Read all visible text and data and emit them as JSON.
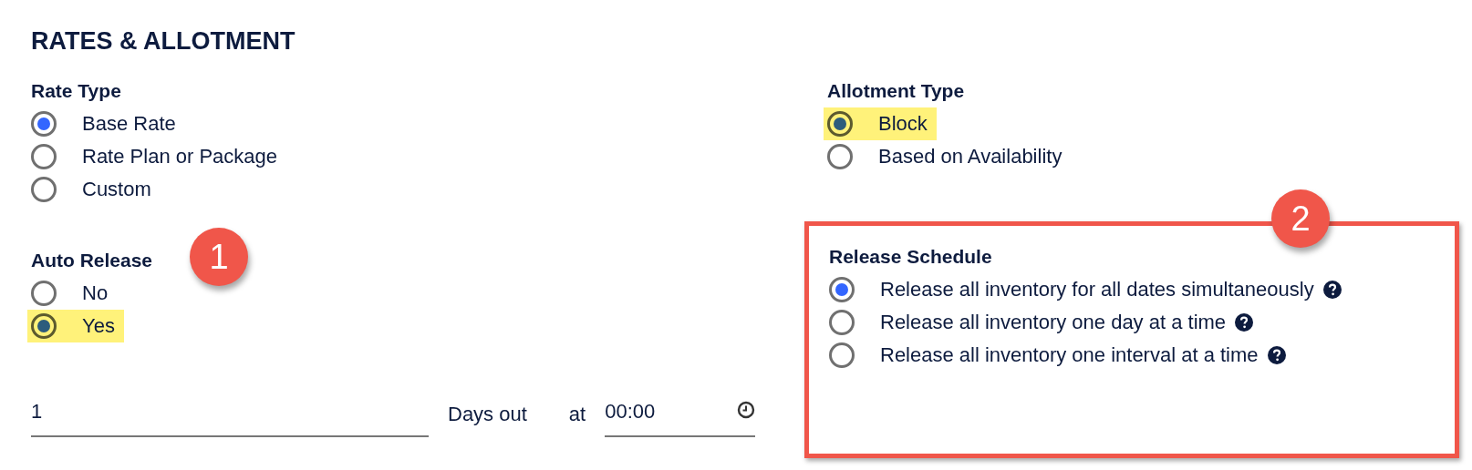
{
  "title": "RATES & ALLOTMENT",
  "rate_type": {
    "label": "Rate Type",
    "options": [
      {
        "label": "Base Rate",
        "selected": true,
        "highlighted": false
      },
      {
        "label": "Rate Plan or Package",
        "selected": false,
        "highlighted": false
      },
      {
        "label": "Custom",
        "selected": false,
        "highlighted": false
      }
    ]
  },
  "auto_release": {
    "label": "Auto Release",
    "callout": "1",
    "options": [
      {
        "label": "No",
        "selected": false,
        "highlighted": false
      },
      {
        "label": "Yes",
        "selected": true,
        "highlighted": true
      }
    ]
  },
  "release_fields": {
    "days": {
      "value": "1"
    },
    "days_label": "Days out",
    "at_label": "at",
    "time": {
      "value": "00:00"
    }
  },
  "allotment_type": {
    "label": "Allotment Type",
    "options": [
      {
        "label": "Block",
        "selected": true,
        "highlighted": true
      },
      {
        "label": "Based on Availability",
        "selected": false,
        "highlighted": false
      }
    ]
  },
  "release_schedule": {
    "label": "Release Schedule",
    "callout": "2",
    "framed": true,
    "options": [
      {
        "label": "Release all inventory for all dates simultaneously",
        "selected": true,
        "highlighted": false,
        "help": true
      },
      {
        "label": "Release all inventory one day at a time",
        "selected": false,
        "highlighted": false,
        "help": true
      },
      {
        "label": "Release all inventory one interval at a time",
        "selected": false,
        "highlighted": false,
        "help": true
      }
    ]
  }
}
